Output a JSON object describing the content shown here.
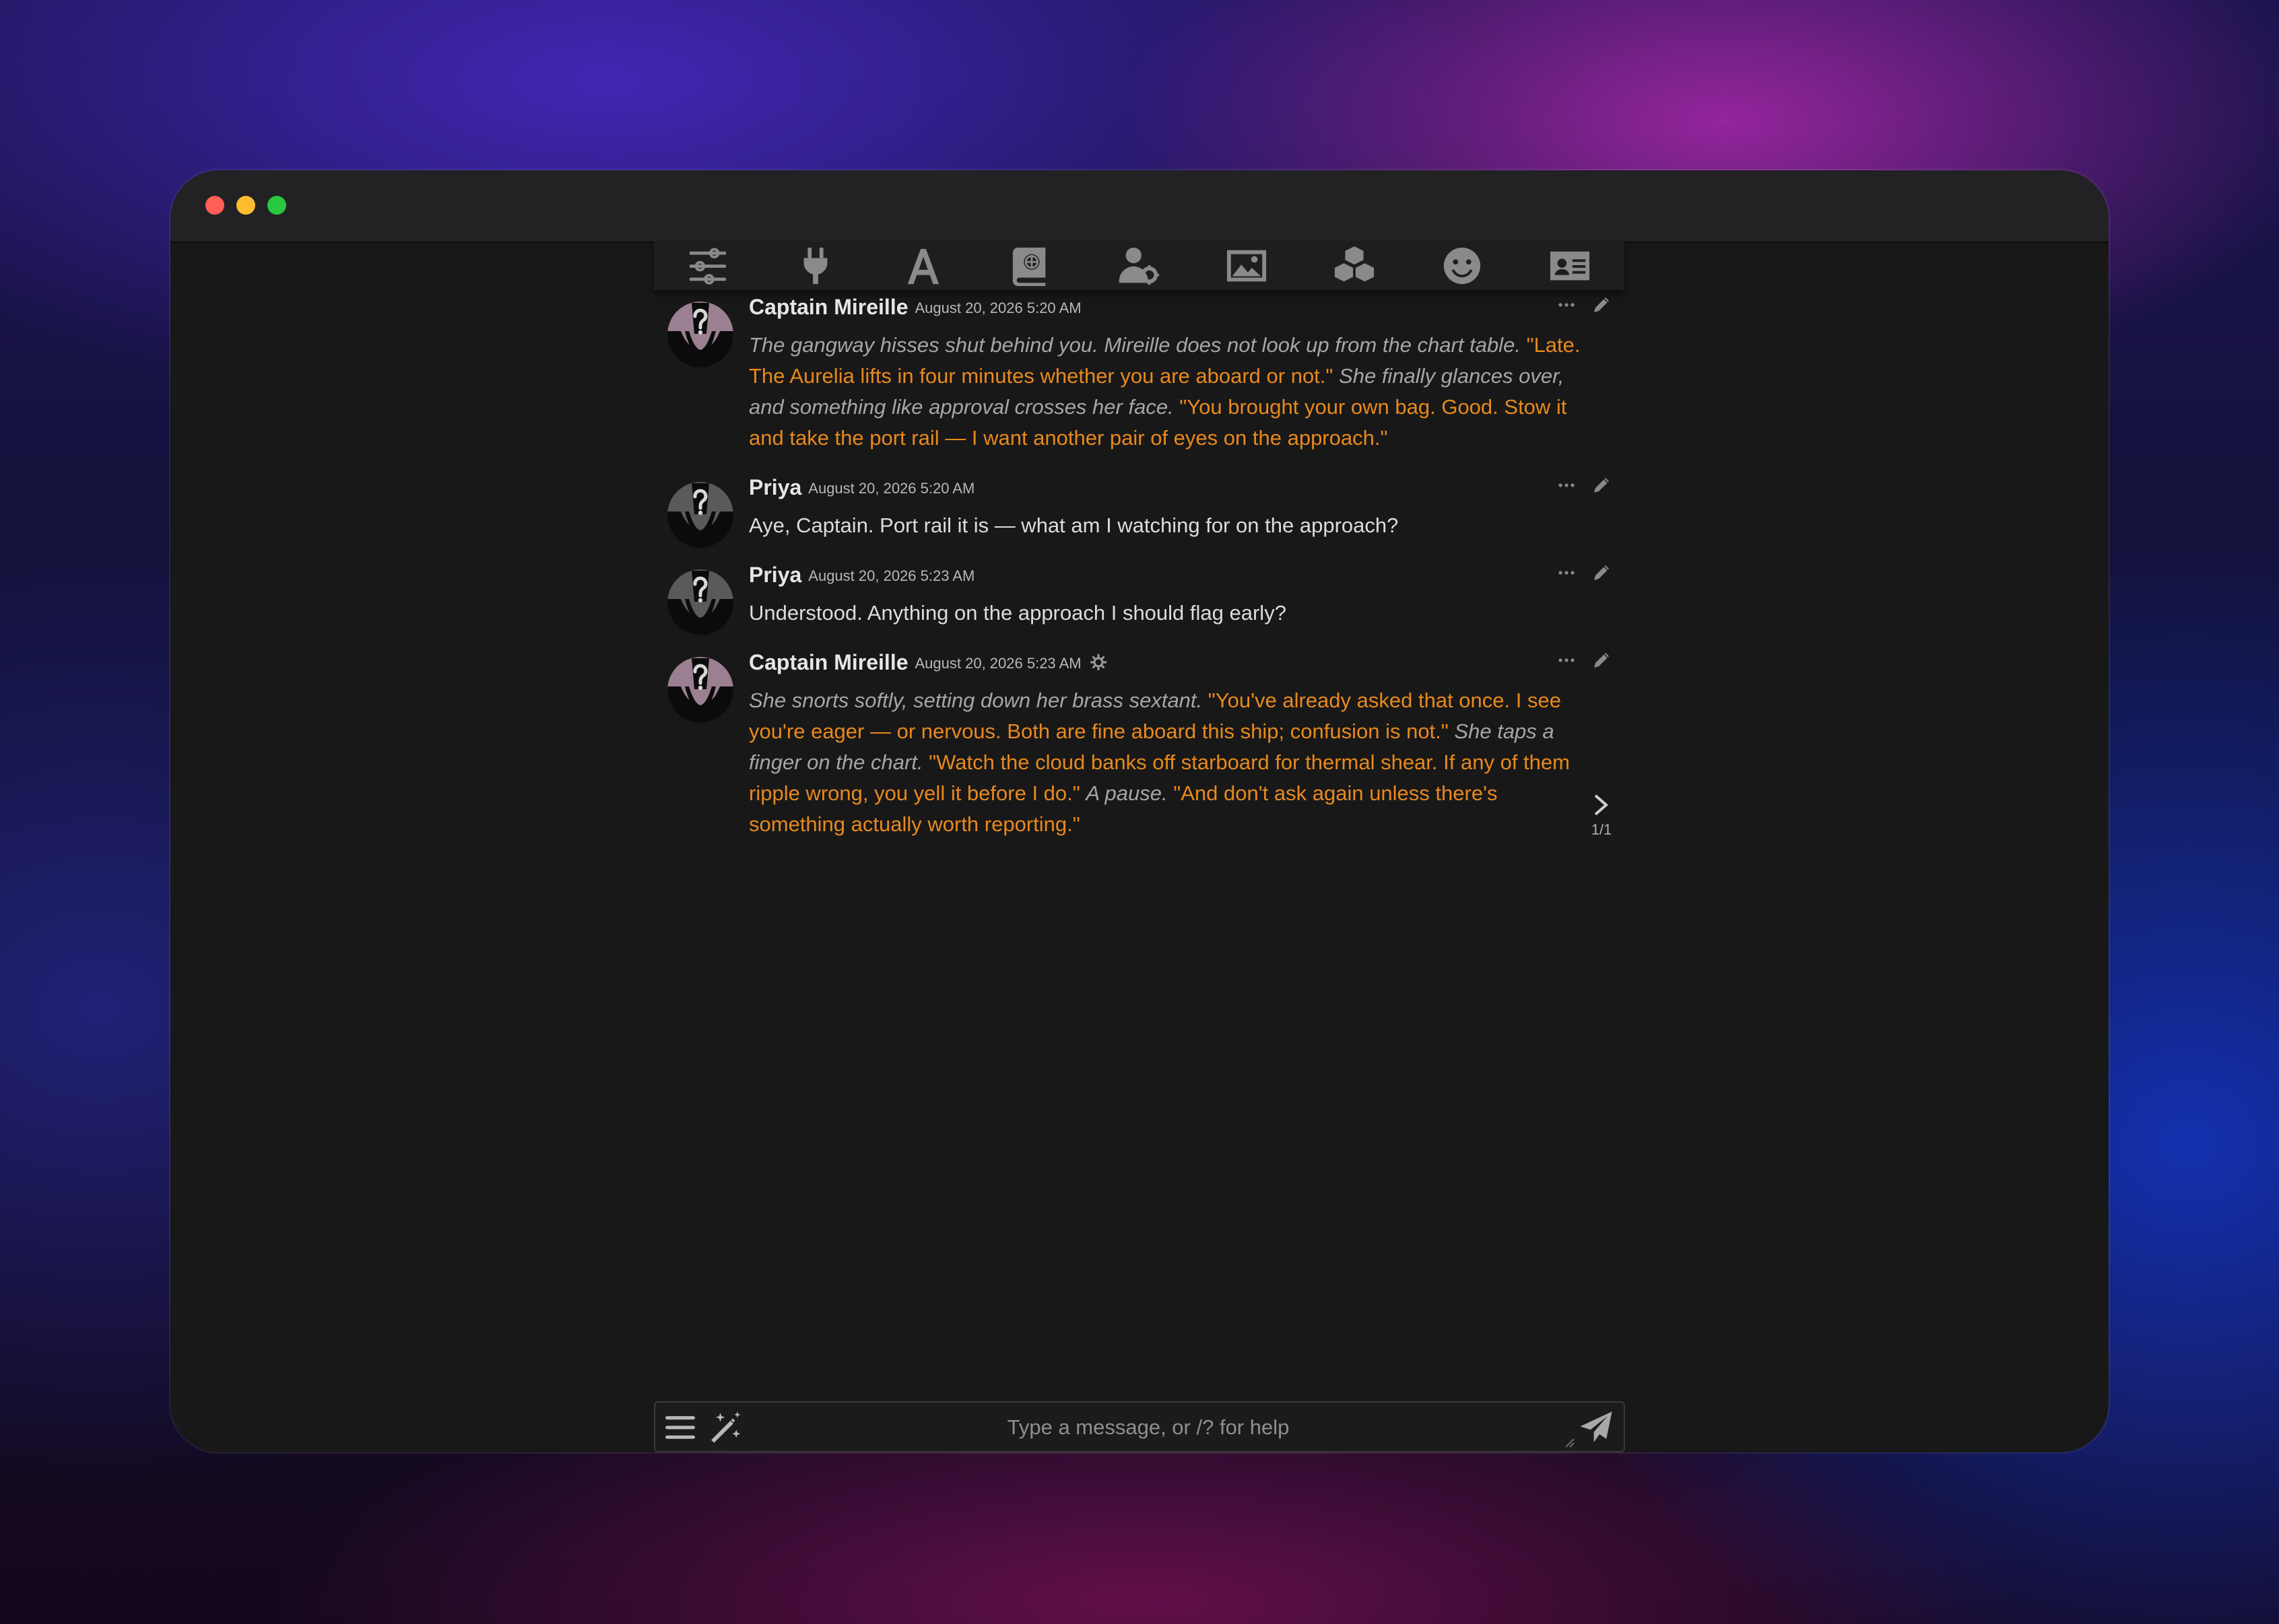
{
  "window": {
    "controls": [
      "close",
      "minimize",
      "maximize"
    ]
  },
  "toolbar": {
    "icons": [
      "sliders-icon",
      "plug-icon",
      "font-icon",
      "book-atlas-icon",
      "user-gear-icon",
      "image-icon",
      "cubes-icon",
      "face-smile-icon",
      "id-card-icon"
    ]
  },
  "messages": [
    {
      "name": "Captain Mireille",
      "time": "August 20, 2026 5:20 AM",
      "segments": [
        {
          "style": "narration",
          "text": "The gangway hisses shut behind you. Mireille does not look up from the chart table."
        },
        {
          "style": "quote",
          "text": "\"Late. The Aurelia lifts in four minutes whether you are aboard or not.\""
        },
        {
          "style": "narration",
          "text": "She finally glances over, and something like approval crosses her face."
        },
        {
          "style": "quote",
          "text": "\"You brought your own bag. Good. Stow it and take the port rail — I want another pair of eyes on the approach.\""
        }
      ]
    },
    {
      "name": "Priya",
      "time": "August 20, 2026 5:20 AM",
      "segments": [
        {
          "style": "plain",
          "text": "Aye, Captain. Port rail it is — what am I watching for on the approach?"
        }
      ]
    },
    {
      "name": "Priya",
      "time": "August 20, 2026 5:23 AM",
      "segments": [
        {
          "style": "plain",
          "text": "Understood. Anything on the approach I should flag early?"
        }
      ]
    },
    {
      "name": "Captain Mireille",
      "time": "August 20, 2026 5:23 AM",
      "segments": [
        {
          "style": "narration",
          "text": "She snorts softly, setting down her brass sextant."
        },
        {
          "style": "quote",
          "text": "\"You've already asked that once. I see you're eager — or nervous. Both are fine aboard this ship; confusion is not.\""
        },
        {
          "style": "narration",
          "text": "She taps a finger on the chart."
        },
        {
          "style": "quote",
          "text": "\"Watch the cloud banks off starboard for thermal shear. If any of them ripple wrong, you yell it before I do.\""
        },
        {
          "style": "narration",
          "text": "A pause."
        },
        {
          "style": "quote",
          "text": "\"And don't ask again unless there's something actually worth reporting.\""
        }
      ],
      "swipe_counter": "1/1"
    }
  ],
  "composer": {
    "placeholder": "Type a message, or /? for help",
    "value": ""
  },
  "colors": {
    "narration": "#a6a6a6",
    "quote": "#e8891d",
    "plain": "#dcdcdc",
    "background": "#181818"
  }
}
